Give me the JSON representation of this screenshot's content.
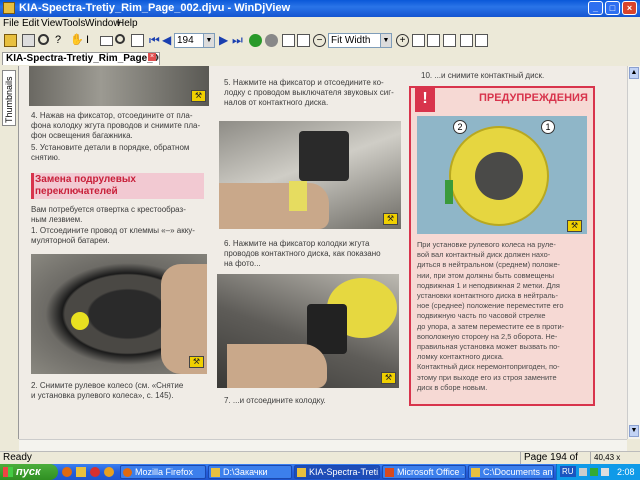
{
  "window": {
    "title": "KIA-Spectra-Tretiy_Rim_Page_002.djvu - WinDjView"
  },
  "menu": [
    "File",
    "Edit",
    "View",
    "Tools",
    "Window",
    "Help"
  ],
  "toolbar": {
    "page_number": "194",
    "zoom": "Fit Width"
  },
  "tab": {
    "label": "KIA-Spectra-Tretiy_Rim_Page_002...."
  },
  "sidebar": {
    "thumbnails_label": "Thumbnails"
  },
  "document": {
    "left_col": {
      "step4": "4. Нажав на фиксатор, отсоедините от пла-\nфона колодку жгута проводов и снимите пла-\nфон освещения багажника.",
      "step5": "5. Установите детали в порядке, обратном\nснятию.",
      "heading": "Замена подрулевых\nпереключателей",
      "intro": "Вам потребуется отвертка с крестообраз-\nным лезвием.",
      "step1": "1. Отсоедините провод от клеммы «–» акку-\nмуляторной батареи.",
      "step2": "2. Снимите рулевое колесо (см. «Снятие\nи установка рулевого колеса», с. 145)."
    },
    "mid_col": {
      "step5": "5. Нажмите на фиксатор и отсоедините ко-\nлодку с проводом выключателя звуковых сиг-\nналов от контактного диска.",
      "step6": "6. Нажмите на фиксатор колодки жгута\nпроводов контактного диска, как показано\nна фото...",
      "step7": "7. ...и отсоедините колодку."
    },
    "right_col": {
      "step10": "10. ...и снимите контактный диск.",
      "warning_title": "ПРЕДУПРЕЖДЕНИЯ",
      "warning_mark": "!",
      "callout1": "1",
      "callout2": "2",
      "warning_text": "При установке рулевого колеса на руле-\nвой вал контактный диск должен нахо-\nдиться в нейтральном (среднем) положе-\nнии, при этом должны быть совмещены\nподвижная 1 и неподвижная 2 метки. Для\nустановки контактного диска в нейтраль-\nное (среднее) положение переместите его\nподвижную часть по часовой стрелке\nдо упора, а затем переместите ее в проти-\nвоположную сторону на 2,5 оборота. Не-\nправильная установка может вызвать по-\nломку контактного диска.\nКонтактный диск неремонтопригоден, по-\nэтому при выходе его из строя замените\nдиск в сборе новым."
    }
  },
  "status": {
    "ready": "Ready",
    "page_info": "Page 194 of 296",
    "size": "40,43 x 57,02 cm"
  },
  "taskbar": {
    "start": "пуск",
    "tasks": [
      "Mozilla Firefox",
      "D:\\Закачки",
      "KIA-Spectra-Treti...",
      "Microsoft Office ...",
      "C:\\Documents an..."
    ],
    "lang": "RU",
    "clock": "2:08"
  },
  "colors": {
    "accent": "#245edb",
    "warning_red": "#d8344c",
    "warning_panel": "#f6d9d4"
  }
}
